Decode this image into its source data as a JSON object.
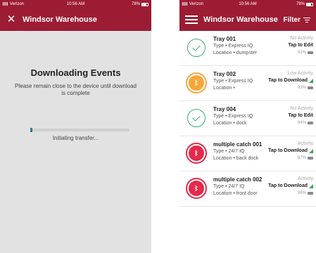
{
  "left": {
    "status": {
      "carrier": "Verizon",
      "time": "10:56 AM",
      "battery": "78%"
    },
    "header": {
      "title": "Windsor Warehouse",
      "close_icon": "close-icon"
    },
    "download": {
      "title": "Downloading Events",
      "subtitle": "Please remain close to the device until download is complete",
      "progress": 0.02,
      "progress_text": "Initiating transfer..."
    }
  },
  "right": {
    "status": {
      "carrier": "Verizon",
      "time": "10:56 AM",
      "battery": "78%"
    },
    "header": {
      "title": "Windsor Warehouse",
      "filter_label": "Filter",
      "menu_icon": "hamburger-icon"
    },
    "devices": [
      {
        "name": "Tray 001",
        "type": "Type • Express IQ",
        "location": "Location • dumpster",
        "activity": "No Activity",
        "action": "Tap to Edit",
        "battery": "92%",
        "icon": "check",
        "signal": false
      },
      {
        "name": "Tray 002",
        "type": "Type • Express IQ",
        "location": "Location •",
        "activity": "Low Activity",
        "action": "Tap to Download",
        "battery": "93%",
        "icon": "bluetooth-orange",
        "signal": true
      },
      {
        "name": "Tray 004",
        "type": "Type • Express IQ",
        "location": "Location • dock",
        "activity": "No Activity",
        "action": "Tap to Edit",
        "battery": "94%",
        "icon": "check",
        "signal": false
      },
      {
        "name": "multiple catch 001",
        "type": "Type • 24/7 IQ",
        "location": "Location • back dock",
        "activity": "Activity",
        "action": "Tap to Download",
        "battery": "97%",
        "icon": "bluetooth-red",
        "signal": true
      },
      {
        "name": "multiple catch 002",
        "type": "Type • 24/7 IQ",
        "location": "Location • front door",
        "activity": "Activity",
        "action": "Tap to Download",
        "battery": "96%",
        "icon": "bluetooth-red",
        "signal": true
      }
    ]
  },
  "colors": {
    "appbar": "#9c1c34",
    "progress": "#6cc9d8",
    "check": "#3bb36e",
    "orange": "#f7a63b",
    "red": "#e5294a",
    "signal": "#2fa74d"
  }
}
